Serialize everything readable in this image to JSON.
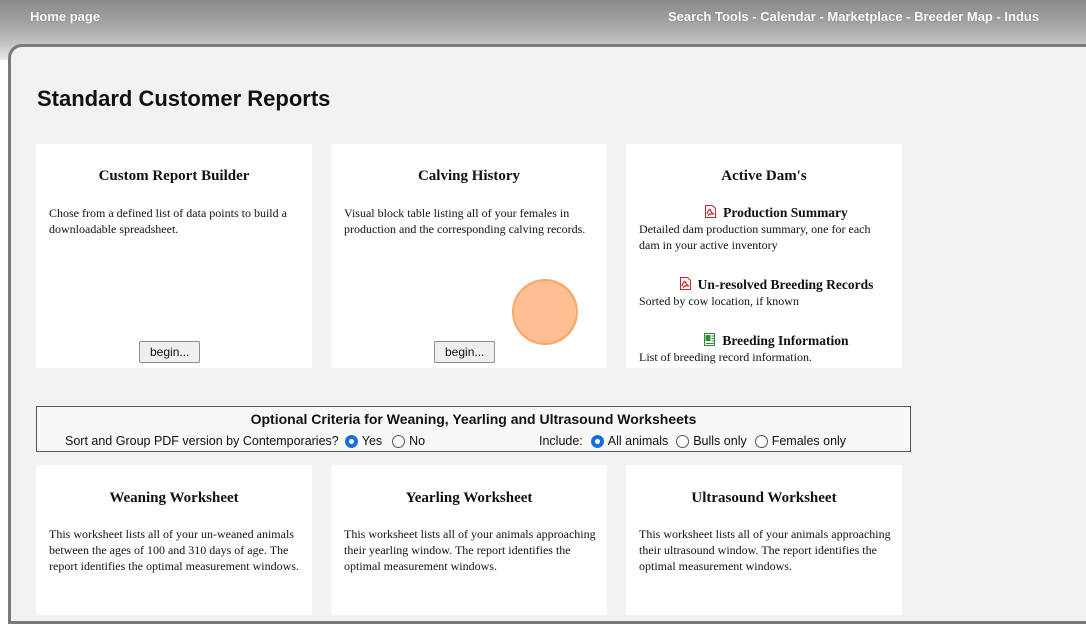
{
  "header": {
    "home_link": "Home page",
    "nav_links": "Search Tools - Calendar - Marketplace - Breeder Map - Indus"
  },
  "page": {
    "title": "Standard Customer Reports"
  },
  "cards": {
    "custom_report": {
      "title": "Custom Report Builder",
      "description": "Chose from a defined list of data points to build a downloadable spreadsheet.",
      "button": "begin..."
    },
    "calving_history": {
      "title": "Calving History",
      "description": "Visual block table listing all of your females in production and the corresponding calving records.",
      "button": "begin..."
    },
    "active_dams": {
      "title": "Active Dam's",
      "reports": [
        {
          "title": "Production Summary",
          "icon": "pdf-icon",
          "description": "Detailed dam production summary, one for each dam in your active inventory"
        },
        {
          "title": "Un-resolved Breeding Records",
          "icon": "pdf-icon",
          "description": "Sorted by cow location, if known"
        },
        {
          "title": "Breeding Information",
          "icon": "excel-icon",
          "description": "List of breeding record information."
        }
      ]
    }
  },
  "criteria": {
    "title": "Optional Criteria for Weaning, Yearling and Ultrasound Worksheets",
    "sort_label": "Sort and Group PDF version by Contemporaries?",
    "sort_options": {
      "yes": "Yes",
      "no": "No"
    },
    "sort_selected": "Yes",
    "include_label": "Include:",
    "include_options": {
      "all": "All animals",
      "bulls": "Bulls only",
      "females": "Females only"
    },
    "include_selected": "All animals"
  },
  "worksheets": {
    "weaning": {
      "title": "Weaning Worksheet",
      "description": "This worksheet lists all of your un-weaned animals between the ages of 100 and 310 days of age. The report identifies the optimal measurement windows."
    },
    "yearling": {
      "title": "Yearling Worksheet",
      "description": "This worksheet lists all of your animals approaching their yearling window. The report identifies the optimal measurement windows."
    },
    "ultrasound": {
      "title": "Ultrasound Worksheet",
      "description": "This worksheet lists all of your animals approaching their ultrasound window. The report identifies the optimal measurement windows."
    }
  },
  "colors": {
    "radio_selected": "#1a6fe0",
    "pdf_red": "#c0282d",
    "excel_green": "#2f8a3a",
    "cursor": "#ffaa6e"
  }
}
